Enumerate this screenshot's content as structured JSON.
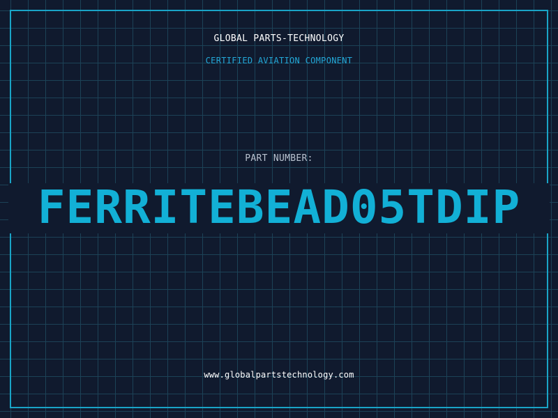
{
  "header": {
    "company": "GLOBAL PARTS-TECHNOLOGY",
    "subtitle": "CERTIFIED AVIATION COMPONENT"
  },
  "part": {
    "label": "PART NUMBER:",
    "number": "FERRITEBEAD05TDIP"
  },
  "footer": {
    "url": "www.globalpartstechnology.com"
  },
  "colors": {
    "background": "#101a2e",
    "grid": "#1c4257",
    "accent": "#12b0d6",
    "frame": "#19a4c7"
  }
}
